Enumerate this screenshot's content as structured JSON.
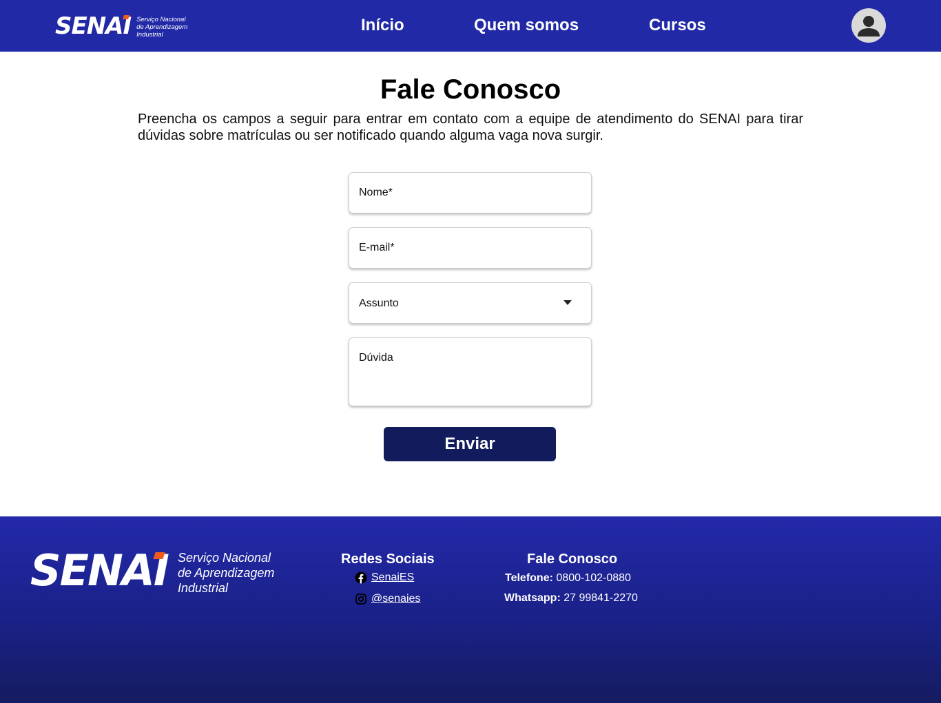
{
  "header": {
    "logo": {
      "word": "SENAI",
      "tagline_1": "Serviço Nacional",
      "tagline_2": "de Aprendizagem",
      "tagline_3": "Industrial"
    },
    "nav": [
      "Início",
      "Quem somos",
      "Cursos"
    ],
    "avatar_icon": "user-avatar-icon"
  },
  "main": {
    "title": "Fale Conosco",
    "intro": "Preencha os campos a seguir para entrar em contato com a equipe de atendimento do SENAI para tirar dúvidas sobre matrículas ou ser notificado quando alguma vaga nova surgir.",
    "form": {
      "name_placeholder": "Nome*",
      "email_placeholder": "E-mail*",
      "subject_label": "Assunto",
      "question_placeholder": "Dúvida",
      "submit_label": "Enviar"
    }
  },
  "footer": {
    "logo": {
      "word": "SENAI",
      "tagline_1": "Serviço Nacional",
      "tagline_2": "de Aprendizagem",
      "tagline_3": "Industrial"
    },
    "social": {
      "title": "Redes Sociais",
      "facebook": "SenaiES",
      "instagram": "@senaies"
    },
    "contact": {
      "title": "Fale Conosco",
      "phone_label": "Telefone:",
      "phone_value": "0800-102-0880",
      "whatsapp_label": "Whatsapp:",
      "whatsapp_value": "27 99841-2270"
    }
  },
  "colors": {
    "header_bg": "#2129a6",
    "button_bg": "#121c5c",
    "logo_accent": "#ef5a1f"
  }
}
